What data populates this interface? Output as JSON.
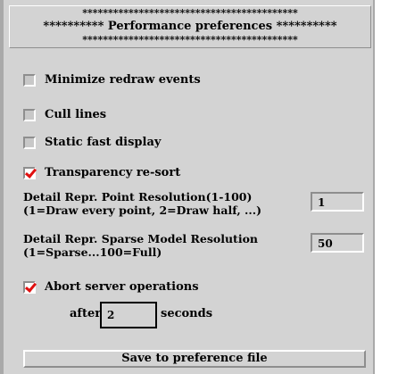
{
  "header": {
    "stars_line": "******************************************",
    "title": "********** Performance preferences **********"
  },
  "options": {
    "minimize_redraw": {
      "label": "Minimize redraw events",
      "checked": false
    },
    "cull_lines": {
      "label": "Cull lines",
      "checked": false
    },
    "static_fast": {
      "label": "Static fast display",
      "checked": false
    },
    "transparency": {
      "label": "Transparency re-sort",
      "checked": true
    },
    "abort_server": {
      "label": "Abort server operations",
      "checked": true
    }
  },
  "point_resolution": {
    "line1": "Detail Repr. Point Resolution(1-100)",
    "line2": "(1=Draw every point, 2=Draw half, ...)",
    "value": "1"
  },
  "sparse_resolution": {
    "line1": "Detail Repr. Sparse Model Resolution",
    "line2": "(1=Sparse...100=Full)",
    "value": "50"
  },
  "abort_after": {
    "prefix": "after",
    "value": "2",
    "suffix": "seconds"
  },
  "save_button": "Save to preference file",
  "colors": {
    "panel": "#d3d3d3",
    "check": "#e01010"
  }
}
